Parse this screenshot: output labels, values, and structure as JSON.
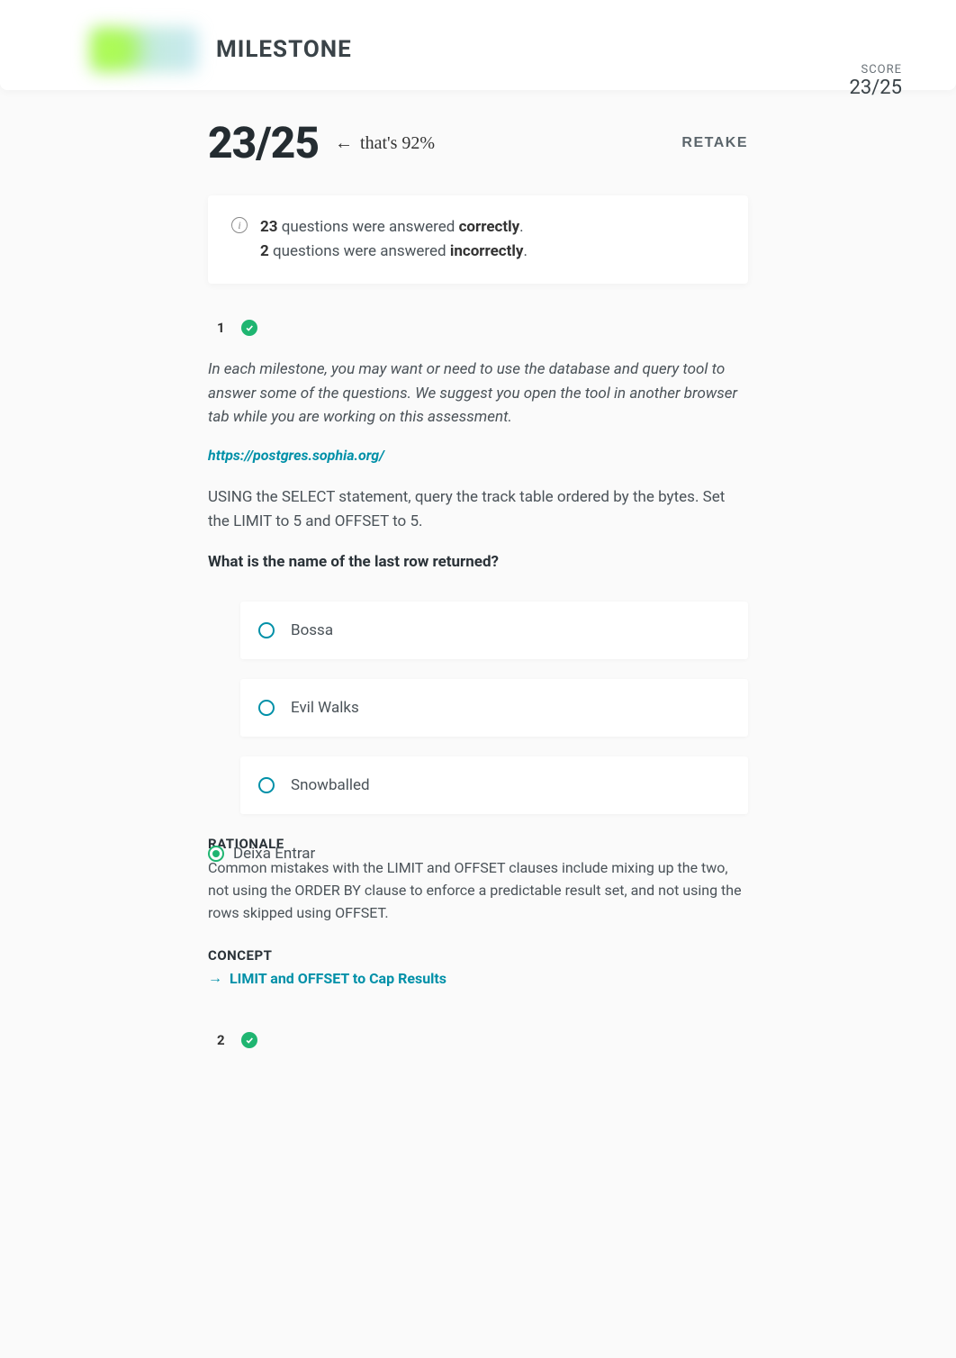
{
  "header": {
    "title": "MILESTONE",
    "score_label": "SCORE",
    "score_value": "23/25"
  },
  "result": {
    "big_score": "23/25",
    "thats": "that's 92%",
    "retake": "RETAKE"
  },
  "summary": {
    "line1_num": "23",
    "line1_mid": " questions were answered ",
    "line1_bold": "correctly",
    "line2_num": "2",
    "line2_mid": " questions were answered ",
    "line2_bold": "incorrectly"
  },
  "q1": {
    "number": "1",
    "instruction": "In each milestone, you may want or need to use the database and query tool to answer some of the questions. We suggest you open the tool in another browser tab while you are working on this assessment.",
    "link": "https://postgres.sophia.org/",
    "body": "USING the SELECT statement, query the track table ordered by the bytes. Set the LIMIT to 5 and OFFSET to 5.",
    "prompt": "What is the name of the last row returned?",
    "answers": [
      "Bossa",
      "Evil Walks",
      "Snowballed"
    ],
    "correct_answer": "Deixa Entrar",
    "rationale_label": "RATIONALE",
    "rationale_prefix": "Common mistakes with the LIMIT and OFFSET clauses include mixing up the two, not using the ORDER BY clause to enforce a predictable result set, and not using the rows skipped using OFFSET.",
    "concept_label": "CONCEPT",
    "concept_link": "LIMIT and OFFSET to Cap Results"
  },
  "q2": {
    "number": "2"
  }
}
